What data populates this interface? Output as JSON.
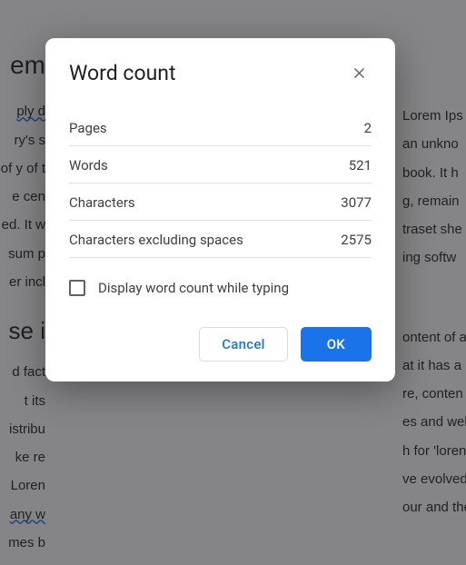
{
  "dialog": {
    "title": "Word count",
    "stats": [
      {
        "label": "Pages",
        "value": "2"
      },
      {
        "label": "Words",
        "value": "521"
      },
      {
        "label": "Characters",
        "value": "3077"
      },
      {
        "label": "Characters excluding spaces",
        "value": "2575"
      }
    ],
    "checkbox_label": "Display word count while typing",
    "cancel_label": "Cancel",
    "ok_label": "OK"
  },
  "background": {
    "heading1": "em",
    "para1a": "ply d",
    "para1b": "ry's s",
    "para1c": " of y of t",
    "para1d": "e cen",
    "para1e": "ed. It w",
    "para1f": "sum p",
    "para1g": "er incl",
    "heading2": "se i",
    "para2a": "d fact",
    "para2b": "t its ",
    "para2c": "istribu",
    "para2d": "ke re",
    "para2e": " Loren",
    "para2f": "any w",
    "para2g": "mes b",
    "right1": " Lorem Ips",
    "right2": " an unkno",
    "right3": " book. It h",
    "right4": "g, remain",
    "right5": "traset she",
    "right6": "ing softw",
    "right7": "ontent of a",
    "right8": "at it has a",
    "right9": "re, conten",
    "right10": "es and wel",
    "right11": "h for 'loren",
    "right12": "ve evolved",
    "right13": "our and the"
  }
}
